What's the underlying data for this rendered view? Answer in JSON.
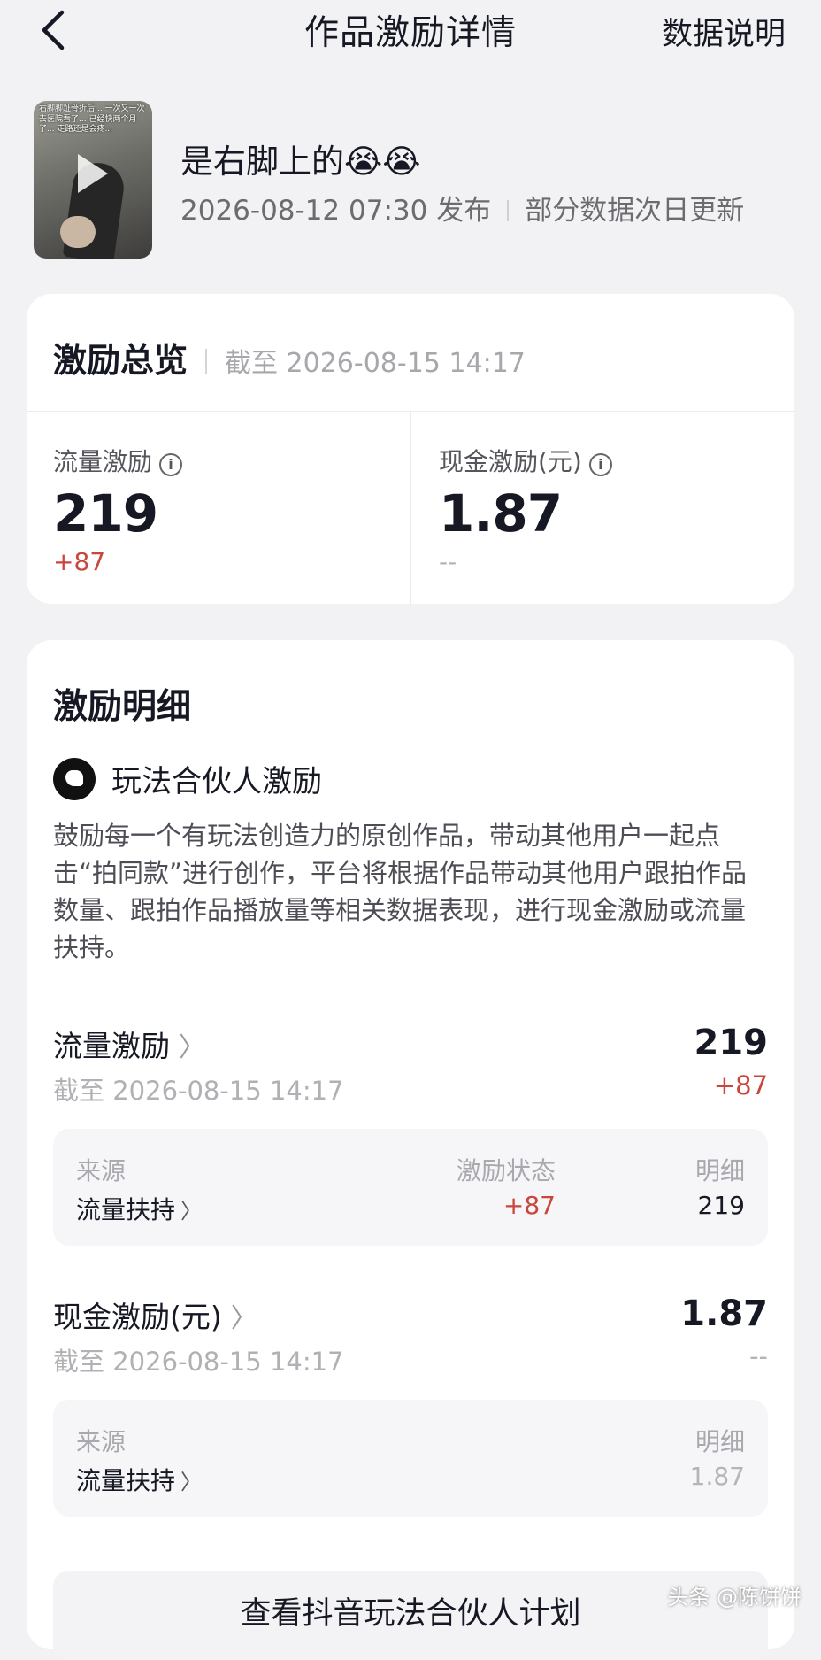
{
  "header": {
    "back_icon": "chevron-left-icon",
    "title": "作品激励详情",
    "help_label": "数据说明"
  },
  "video": {
    "thumbnail_caption": "右脚脚趾骨折后... 一次又一次去医院看了... 已经快两个月了... 走路还是会疼...",
    "title": "是右脚上的😭😭",
    "publish_time": "2026-08-12 07:30 发布",
    "update_note": "部分数据次日更新"
  },
  "overview": {
    "title": "激励总览",
    "as_of": "截至 2026-08-15 14:17",
    "traffic": {
      "label": "流量激励",
      "value": "219",
      "change": "+87"
    },
    "cash": {
      "label": "现金激励(元)",
      "value": "1.87",
      "change": "--"
    }
  },
  "details": {
    "title": "激励明细",
    "program": {
      "name": "玩法合伙人激励",
      "description": "鼓励每一个有玩法创造力的原创作品，带动其他用户一起点击“拍同款”进行创作，平台将根据作品带动其他用户跟拍作品数量、跟拍作品播放量等相关数据表现，进行现金激励或流量扶持。"
    },
    "traffic_row": {
      "title": "流量激励",
      "as_of": "截至 2026-08-15 14:17",
      "value": "219",
      "change": "+87",
      "table": {
        "col_source": "来源",
        "col_status": "激励状态",
        "col_detail": "明细",
        "source": "流量扶持",
        "status": "+87",
        "detail": "219"
      }
    },
    "cash_row": {
      "title": "现金激励(元)",
      "as_of": "截至 2026-08-15 14:17",
      "value": "1.87",
      "change": "--",
      "table": {
        "col_source": "来源",
        "col_detail": "明细",
        "source": "流量扶持",
        "detail": "1.87"
      }
    },
    "cta_label": "查看抖音玩法合伙人计划"
  },
  "watermark": "头条 @陈饼饼",
  "colors": {
    "background": "#f2f2f4",
    "card": "#ffffff",
    "positive": "#c9463d",
    "muted": "#b0b0b5"
  }
}
